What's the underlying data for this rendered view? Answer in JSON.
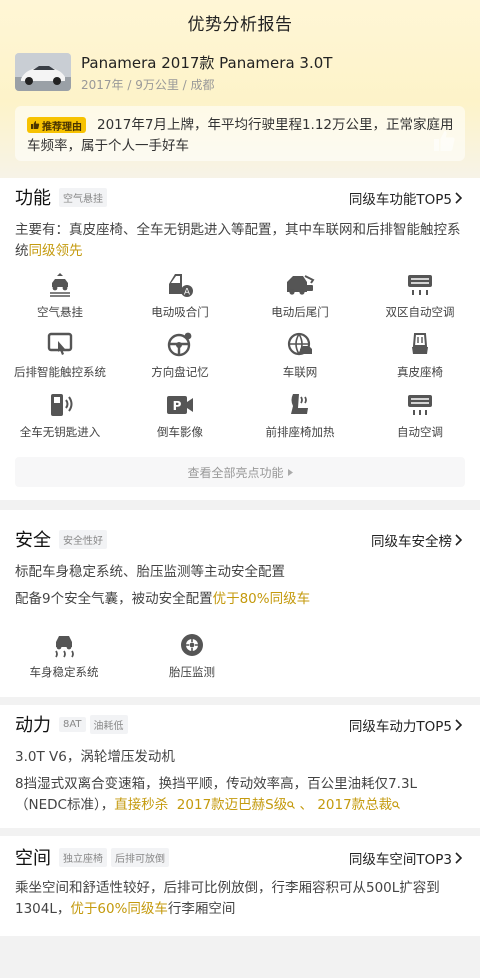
{
  "page": {
    "title": "优势分析报告"
  },
  "car": {
    "name": "Panamera 2017款 Panamera 3.0T",
    "meta": "2017年 / 9万公里 / 成都"
  },
  "reason": {
    "badge": "推荐理由",
    "text": "2017年7月上牌，年平均行驶里程1.12万公里，正常家庭用车频率，属于个人一手好车"
  },
  "function": {
    "title": "功能",
    "tag": "空气悬挂",
    "rank": "同级车功能TOP5",
    "desc_prefix": "主要有：真皮座椅、全车无钥匙进入等配置，其中车联网和后排智能触控系统",
    "desc_highlight": "同级领先",
    "features": [
      {
        "label": "空气悬挂",
        "icon": "air-suspension-icon"
      },
      {
        "label": "电动吸合门",
        "icon": "soft-close-door-icon"
      },
      {
        "label": "电动后尾门",
        "icon": "power-tailgate-icon"
      },
      {
        "label": "双区自动空调",
        "icon": "dual-zone-ac-icon"
      },
      {
        "label": "后排智能触控系统",
        "icon": "rear-touch-control-icon"
      },
      {
        "label": "方向盘记忆",
        "icon": "steering-memory-icon"
      },
      {
        "label": "车联网",
        "icon": "connected-car-icon"
      },
      {
        "label": "真皮座椅",
        "icon": "leather-seat-icon"
      },
      {
        "label": "全车无钥匙进入",
        "icon": "keyless-entry-icon"
      },
      {
        "label": "倒车影像",
        "icon": "reverse-camera-icon"
      },
      {
        "label": "前排座椅加热",
        "icon": "seat-heating-icon"
      },
      {
        "label": "自动空调",
        "icon": "auto-ac-icon"
      }
    ],
    "more": "查看全部亮点功能"
  },
  "safety": {
    "title": "安全",
    "tag": "安全性好",
    "rank": "同级车安全榜",
    "line1": "标配车身稳定系统、胎压监测等主动安全配置",
    "line2_prefix": "配备9个安全气囊，被动安全配置",
    "line2_highlight": "优于80%同级车",
    "features": [
      {
        "label": "车身稳定系统",
        "icon": "stability-control-icon"
      },
      {
        "label": "胎压监测",
        "icon": "tire-pressure-icon"
      }
    ]
  },
  "power": {
    "title": "动力",
    "tags": [
      "8AT",
      "油耗低"
    ],
    "rank": "同级车动力TOP5",
    "line1": "3.0T V6，涡轮增压发动机",
    "line2": "8挡湿式双离合变速箱，换挡平顺，传动效率高，百公里油耗仅7.3L（NEDC标准），",
    "compare_prefix": "直接秒杀",
    "compare_a": "2017款迈巴赫S级",
    "compare_sep": "、",
    "compare_b": "2017款总裁"
  },
  "space": {
    "title": "空间",
    "tags": [
      "独立座椅",
      "后排可放倒"
    ],
    "rank": "同级车空间TOP3",
    "line_prefix": "乘坐空间和舒适性较好，后排可比例放倒，行李厢容积可从500L扩容到1304L，",
    "line_highlight": "优于60%同级车",
    "line_suffix": "行李厢空间"
  },
  "colors": {
    "accent": "#c49a0e",
    "badge": "#f7c200",
    "icon": "#555555"
  }
}
